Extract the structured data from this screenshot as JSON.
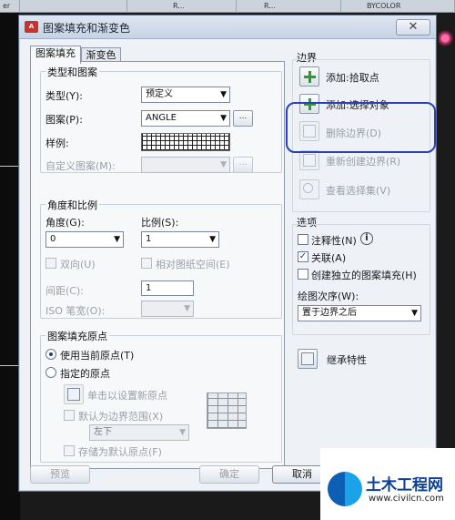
{
  "background": {
    "top_tabs": [
      "er",
      "R...",
      "R...",
      "BYCOLOR"
    ]
  },
  "dialog": {
    "title": "图案填充和渐变色",
    "close_symbol": "✕",
    "tabs": [
      "图案填充",
      "渐变色"
    ]
  },
  "type_pattern": {
    "group_title": "类型和图案",
    "type_label": "类型(Y):",
    "type_value": "预定义",
    "pattern_label": "图案(P):",
    "pattern_value": "ANGLE",
    "pattern_browse": "...",
    "sample_label": "样例:",
    "custom_label": "自定义图案(M):",
    "custom_browse": "..."
  },
  "angle_scale": {
    "group_title": "角度和比例",
    "angle_label": "角度(G):",
    "angle_value": "0",
    "scale_label": "比例(S):",
    "scale_value": "1",
    "double_label": "双向(U)",
    "relative_label": "相对图纸空间(E)",
    "spacing_label": "间距(C):",
    "spacing_value": "1",
    "iso_label": "ISO 笔宽(O):"
  },
  "origin": {
    "group_title": "图案填充原点",
    "use_current": "使用当前原点(T)",
    "specified": "指定的原点",
    "click_set": "单击以设置新原点",
    "default_extent": "默认为边界范围(X)",
    "position_value": "左下",
    "store_default": "存储为默认原点(F)"
  },
  "boundary": {
    "group_title": "边界",
    "add_pick": "添加:拾取点",
    "add_select": "添加:选择对象",
    "remove": "删除边界(D)",
    "recreate": "重新创建边界(R)",
    "view_selection": "查看选择集(V)"
  },
  "options": {
    "group_title": "选项",
    "annotative": "注释性(N)",
    "info_symbol": "i",
    "associative": "关联(A)",
    "create_separate": "创建独立的图案填充(H)",
    "draw_order_label": "绘图次序(W):",
    "draw_order_value": "置于边界之后",
    "inherit": "继承特性"
  },
  "footer": {
    "preview": "预览",
    "ok": "确定",
    "cancel": "取消"
  },
  "watermark": {
    "title": "土木工程网",
    "url": "www.civilcn.com"
  },
  "colors": {
    "dialog_bg": "#eef1f6",
    "annotation_blue": "#2d3fb8",
    "plus_green": "#2c9a2e"
  }
}
